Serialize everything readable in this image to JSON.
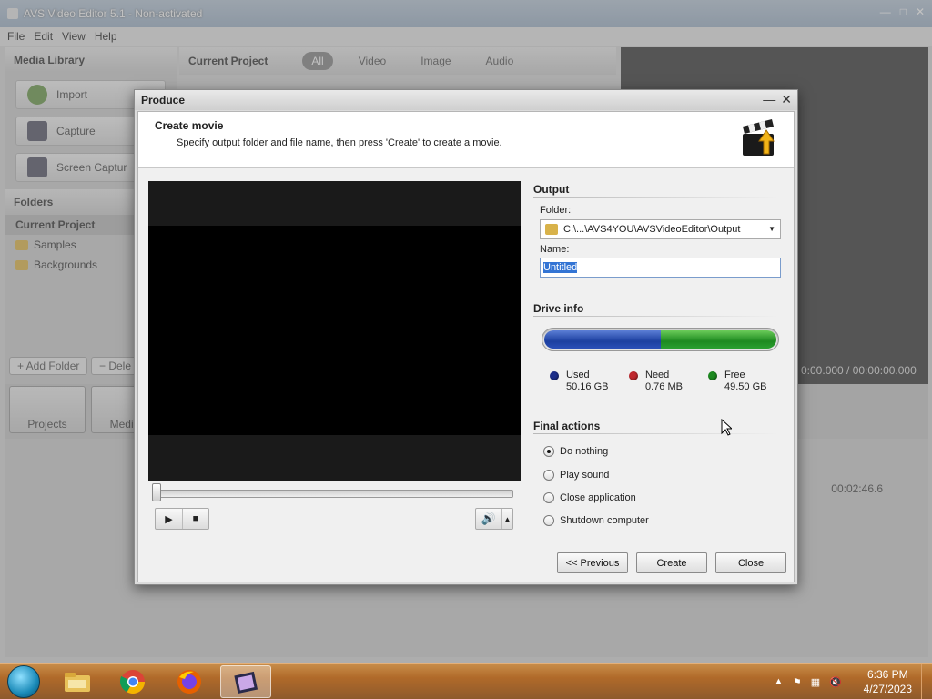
{
  "app": {
    "title": "AVS Video Editor 5.1 - Non-activated",
    "menu": [
      "File",
      "Edit",
      "View",
      "Help"
    ],
    "media_library": {
      "header": "Media Library",
      "buttons": [
        "Import",
        "Capture",
        "Screen Captur"
      ]
    },
    "folders": {
      "header": "Folders",
      "items": [
        "Current Project",
        "Samples",
        "Backgrounds"
      ],
      "add_folder": "+ Add Folder",
      "delete": "− Dele"
    },
    "current_project": {
      "header": "Current Project",
      "filters": [
        "All",
        "Video",
        "Image",
        "Audio"
      ],
      "active_filter": "All"
    },
    "time_readout": "0:00.000 / 00:00:00.000",
    "bottom_tabs": [
      "Projects",
      "Media L"
    ],
    "timeline_time": "00:02:46.6"
  },
  "dialog": {
    "title": "Produce",
    "header_title": "Create movie",
    "header_subtitle": "Specify output folder and file name, then press 'Create' to create a movie.",
    "output": {
      "section": "Output",
      "folder_label": "Folder:",
      "folder_value": "C:\\...\\AVS4YOU\\AVSVideoEditor\\Output",
      "name_label": "Name:",
      "name_value": "Untitled"
    },
    "drive_info": {
      "section": "Drive info",
      "used_fraction": 0.5031,
      "used_label": "Used",
      "used_value": "50.16 GB",
      "need_label": "Need",
      "need_value": "0.76 MB",
      "free_label": "Free",
      "free_value": "49.50 GB",
      "colors": {
        "used": "#1c3fa0",
        "need": "#c0272d",
        "free": "#1d8a20"
      }
    },
    "final_actions": {
      "section": "Final actions",
      "options": [
        "Do nothing",
        "Play sound",
        "Close application",
        "Shutdown computer"
      ],
      "selected": "Do nothing"
    },
    "buttons": {
      "previous": "<< Previous",
      "create": "Create",
      "close": "Close"
    },
    "player": {
      "play_icon": "play-icon",
      "stop_icon": "stop-icon",
      "volume_icon": "speaker-icon"
    }
  },
  "taskbar": {
    "items": [
      "file-explorer-icon",
      "chrome-icon",
      "firefox-icon",
      "avs-video-editor-icon"
    ],
    "active_item": "avs-video-editor-icon",
    "time": "6:36 PM",
    "date": "4/27/2023"
  }
}
